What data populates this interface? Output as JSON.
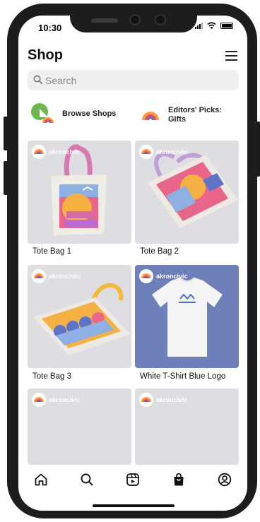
{
  "status": {
    "time": "10:30"
  },
  "header": {
    "title": "Shop"
  },
  "search": {
    "placeholder": "Search"
  },
  "chips": [
    {
      "label": "Browse Shops"
    },
    {
      "label": "Editors' Picks:\nGifts"
    }
  ],
  "products": [
    {
      "shop": "akroncivic",
      "name": "Tote Bag 1"
    },
    {
      "shop": "akroncivic",
      "name": "Tote Bag 2"
    },
    {
      "shop": "akroncivic",
      "name": "Tote Bag 3"
    },
    {
      "shop": "akroncivic",
      "name": "White T-Shirt Blue Logo"
    },
    {
      "shop": "akroncivic",
      "name": ""
    },
    {
      "shop": "akroncivic",
      "name": ""
    }
  ],
  "tabs": [
    "home-icon",
    "search-icon",
    "reels-icon",
    "shop-bag-icon",
    "profile-icon"
  ],
  "colors": {
    "card_bg": "#dedee2",
    "tshirt_bg": "#6d80b9",
    "accent": "#e26a8b"
  }
}
